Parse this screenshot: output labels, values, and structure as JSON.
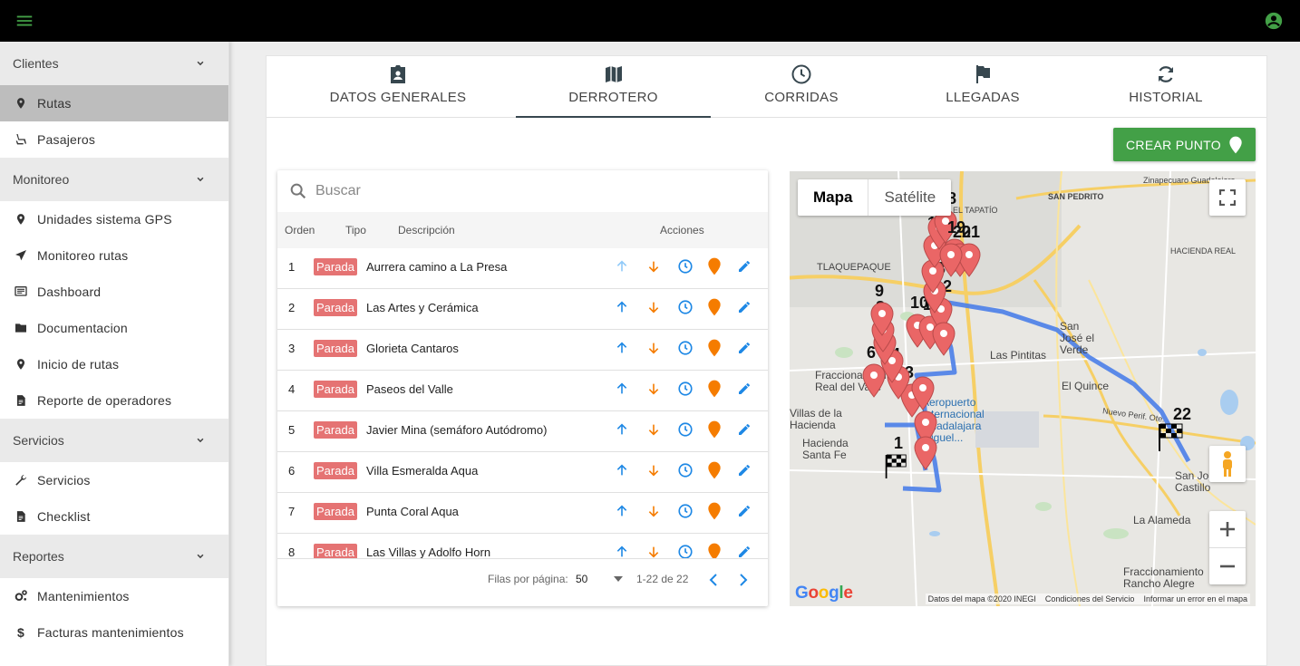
{
  "icons": {
    "menu": "menu-icon",
    "account": "account-circle-icon"
  },
  "sidebar": {
    "sections": [
      {
        "label": "Clientes",
        "items": [
          {
            "label": "Rutas",
            "icon": "place-icon",
            "active": true
          },
          {
            "label": "Pasajeros",
            "icon": "seat-icon"
          }
        ]
      },
      {
        "label": "Monitoreo",
        "items": [
          {
            "label": "Unidades sistema GPS",
            "icon": "place-icon"
          },
          {
            "label": "Monitoreo rutas",
            "icon": "navigation-icon"
          },
          {
            "label": "Dashboard",
            "icon": "dashboard-icon"
          },
          {
            "label": "Documentacion",
            "icon": "folder-icon"
          },
          {
            "label": "Inicio de rutas",
            "icon": "place-icon"
          },
          {
            "label": "Reporte de operadores",
            "icon": "document-icon"
          }
        ]
      },
      {
        "label": "Servicios",
        "items": [
          {
            "label": "Servicios",
            "icon": "wrench-icon"
          },
          {
            "label": "Checklist",
            "icon": "document-icon"
          }
        ]
      },
      {
        "label": "Reportes",
        "items": [
          {
            "label": "Mantenimientos",
            "icon": "gears-icon"
          },
          {
            "label": "Facturas mantenimientos",
            "icon": "dollar-icon"
          }
        ]
      }
    ]
  },
  "tabs": [
    {
      "label": "DATOS GENERALES",
      "icon": "id-card-icon"
    },
    {
      "label": "DERROTERO",
      "icon": "map-icon",
      "active": true
    },
    {
      "label": "CORRIDAS",
      "icon": "clock-icon"
    },
    {
      "label": "LLEGADAS",
      "icon": "flag-icon"
    },
    {
      "label": "HISTORIAL",
      "icon": "sync-icon"
    }
  ],
  "create_button": {
    "label": "CREAR PUNTO",
    "color": "#43a047"
  },
  "table": {
    "search_placeholder": "Buscar",
    "headers": {
      "orden": "Orden",
      "tipo": "Tipo",
      "descripcion": "Descripción",
      "acciones": "Acciones"
    },
    "rows": [
      {
        "orden": "1",
        "tipo": "Parada",
        "descripcion": "Aurrera camino a La Presa"
      },
      {
        "orden": "2",
        "tipo": "Parada",
        "descripcion": "Las Artes y Cerámica"
      },
      {
        "orden": "3",
        "tipo": "Parada",
        "descripcion": "Glorieta Cantaros"
      },
      {
        "orden": "4",
        "tipo": "Parada",
        "descripcion": "Paseos del Valle"
      },
      {
        "orden": "5",
        "tipo": "Parada",
        "descripcion": "Javier Mina (semáforo Autódromo)"
      },
      {
        "orden": "6",
        "tipo": "Parada",
        "descripcion": "Villa Esmeralda Aqua"
      },
      {
        "orden": "7",
        "tipo": "Parada",
        "descripcion": "Punta Coral Aqua"
      },
      {
        "orden": "8",
        "tipo": "Parada",
        "descripcion": "Las Villas y Adolfo Horn"
      }
    ],
    "footer": {
      "rows_per_page_label": "Filas por página:",
      "rows_per_page": "50",
      "range": "1-22 de 22"
    }
  },
  "map": {
    "type_buttons": [
      "Mapa",
      "Satélite"
    ],
    "labels": [
      "TLAQUEPAQUE",
      "SAN PEDRITO",
      "EL TAPATÍO",
      "HACIENDA REAL",
      "Las Pintitas",
      "San José el Verde",
      "El Quince",
      "Aeropuerto Internacional Guadalajara Miguel...",
      "Fraccionamiento Real del Valle",
      "Hacienda Santa Fe",
      "La Alameda",
      "Fraccionamiento Rancho Alegre",
      "San José del Castillo",
      "Zinapecuaro Guadalajara",
      "Nuevo Perif. Ote.",
      "Villas de la Hacienda"
    ],
    "attribution": [
      "Datos del mapa ©2020 INEGI",
      "Condiciones del Servicio",
      "Informar un error en el mapa"
    ],
    "logo": "Google"
  },
  "colors": {
    "route": "#4a7ee8",
    "marker": "#ea6666",
    "badge": "#e57373",
    "blue_action": "#1e88e5",
    "orange_action": "#f57c00"
  }
}
